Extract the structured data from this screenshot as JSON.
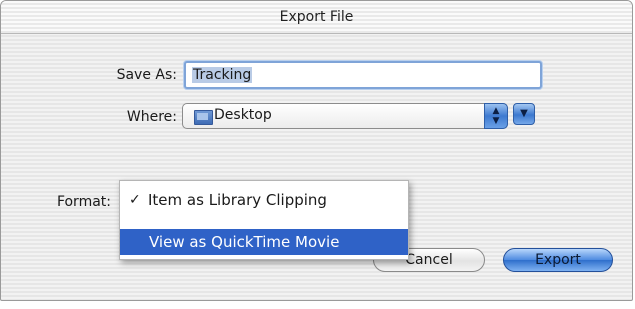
{
  "window": {
    "title": "Export File"
  },
  "save_as": {
    "label": "Save As:",
    "value": "Tracking"
  },
  "where": {
    "label": "Where:",
    "value": "Desktop",
    "icon": "folder-icon"
  },
  "format": {
    "label": "Format:",
    "menu_items": [
      {
        "label": "Item as Library Clipping",
        "checked": true,
        "highlighted": false
      },
      {
        "label": "View as QuickTime Movie",
        "checked": false,
        "highlighted": true
      }
    ]
  },
  "buttons": {
    "cancel": "Cancel",
    "export": "Export"
  },
  "colors": {
    "accent": "#2f62c7",
    "default_button": "#4d8ae0",
    "field_focus": "#7fa4d8"
  }
}
